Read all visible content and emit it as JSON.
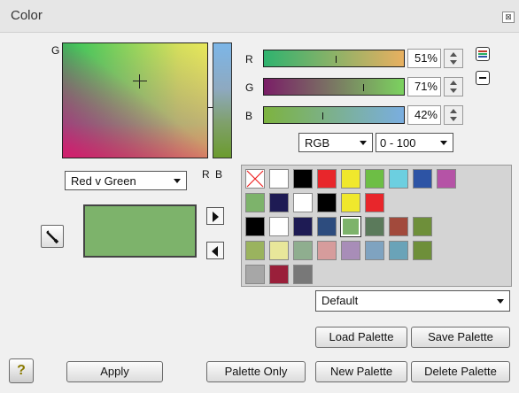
{
  "window": {
    "title": "Color",
    "close_glyph": "⊠"
  },
  "plane": {
    "vertical_axis": "G",
    "horizontal_axis_1": "R",
    "horizontal_axis_2": "B",
    "mode_select": "Red v Green"
  },
  "sliders": [
    {
      "label": "R",
      "percent_text": "51%",
      "value": 0.51
    },
    {
      "label": "G",
      "percent_text": "71%",
      "value": 0.71
    },
    {
      "label": "B",
      "percent_text": "42%",
      "value": 0.42
    }
  ],
  "model_select": "RGB",
  "range_select": "0 - 100%",
  "range_select_visible": "0 - 100",
  "palette_select": "Default",
  "buttons": {
    "load_palette": "Load Palette",
    "save_palette": "Save Palette",
    "new_palette": "New Palette",
    "delete_palette": "Delete Palette",
    "palette_only": "Palette Only",
    "apply": "Apply",
    "help": "?"
  },
  "current_color": "#7db36b",
  "palette_rows": [
    [
      "none",
      "#ffffff",
      "#000000",
      "#e8262b",
      "#f0e82c",
      "#6dbe45",
      "#6ccfe0",
      "#2d54a5",
      "#b553a6"
    ],
    [
      "#7db36b",
      "#1e1b54",
      "#ffffff",
      "#000000",
      "#f0e82c",
      "#e8262b"
    ],
    [
      "#000000",
      "#ffffff",
      "#1e1b54",
      "#2d4c7e",
      "#7db36b",
      "#5b7a5b",
      "#a24a3c",
      "#6e8f3a"
    ],
    [
      "#9ab35e",
      "#e8e79a",
      "#8fae8f",
      "#d69c9c",
      "#a88db8",
      "#7fa3c0",
      "#6aa3b8",
      "#6e8f3a"
    ],
    [
      "#a7a7a7",
      "#9a1f3a",
      "#787878"
    ]
  ],
  "icons": [
    "eyedropper-icon",
    "arrow-right-icon",
    "arrow-left-icon",
    "sliders-icon",
    "minus-icon",
    "help-icon"
  ]
}
